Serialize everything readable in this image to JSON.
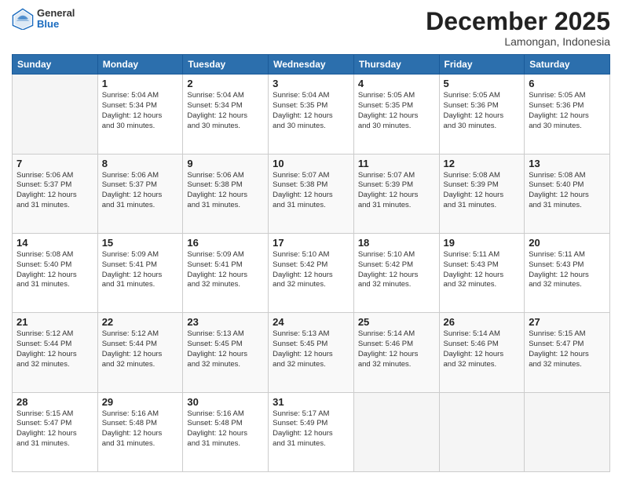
{
  "header": {
    "logo": {
      "general": "General",
      "blue": "Blue"
    },
    "title": "December 2025",
    "subtitle": "Lamongan, Indonesia"
  },
  "days_header": [
    "Sunday",
    "Monday",
    "Tuesday",
    "Wednesday",
    "Thursday",
    "Friday",
    "Saturday"
  ],
  "weeks": [
    [
      {
        "day": "",
        "info": ""
      },
      {
        "day": "1",
        "info": "Sunrise: 5:04 AM\nSunset: 5:34 PM\nDaylight: 12 hours\nand 30 minutes."
      },
      {
        "day": "2",
        "info": "Sunrise: 5:04 AM\nSunset: 5:34 PM\nDaylight: 12 hours\nand 30 minutes."
      },
      {
        "day": "3",
        "info": "Sunrise: 5:04 AM\nSunset: 5:35 PM\nDaylight: 12 hours\nand 30 minutes."
      },
      {
        "day": "4",
        "info": "Sunrise: 5:05 AM\nSunset: 5:35 PM\nDaylight: 12 hours\nand 30 minutes."
      },
      {
        "day": "5",
        "info": "Sunrise: 5:05 AM\nSunset: 5:36 PM\nDaylight: 12 hours\nand 30 minutes."
      },
      {
        "day": "6",
        "info": "Sunrise: 5:05 AM\nSunset: 5:36 PM\nDaylight: 12 hours\nand 30 minutes."
      }
    ],
    [
      {
        "day": "7",
        "info": "Sunrise: 5:06 AM\nSunset: 5:37 PM\nDaylight: 12 hours\nand 31 minutes."
      },
      {
        "day": "8",
        "info": "Sunrise: 5:06 AM\nSunset: 5:37 PM\nDaylight: 12 hours\nand 31 minutes."
      },
      {
        "day": "9",
        "info": "Sunrise: 5:06 AM\nSunset: 5:38 PM\nDaylight: 12 hours\nand 31 minutes."
      },
      {
        "day": "10",
        "info": "Sunrise: 5:07 AM\nSunset: 5:38 PM\nDaylight: 12 hours\nand 31 minutes."
      },
      {
        "day": "11",
        "info": "Sunrise: 5:07 AM\nSunset: 5:39 PM\nDaylight: 12 hours\nand 31 minutes."
      },
      {
        "day": "12",
        "info": "Sunrise: 5:08 AM\nSunset: 5:39 PM\nDaylight: 12 hours\nand 31 minutes."
      },
      {
        "day": "13",
        "info": "Sunrise: 5:08 AM\nSunset: 5:40 PM\nDaylight: 12 hours\nand 31 minutes."
      }
    ],
    [
      {
        "day": "14",
        "info": "Sunrise: 5:08 AM\nSunset: 5:40 PM\nDaylight: 12 hours\nand 31 minutes."
      },
      {
        "day": "15",
        "info": "Sunrise: 5:09 AM\nSunset: 5:41 PM\nDaylight: 12 hours\nand 31 minutes."
      },
      {
        "day": "16",
        "info": "Sunrise: 5:09 AM\nSunset: 5:41 PM\nDaylight: 12 hours\nand 32 minutes."
      },
      {
        "day": "17",
        "info": "Sunrise: 5:10 AM\nSunset: 5:42 PM\nDaylight: 12 hours\nand 32 minutes."
      },
      {
        "day": "18",
        "info": "Sunrise: 5:10 AM\nSunset: 5:42 PM\nDaylight: 12 hours\nand 32 minutes."
      },
      {
        "day": "19",
        "info": "Sunrise: 5:11 AM\nSunset: 5:43 PM\nDaylight: 12 hours\nand 32 minutes."
      },
      {
        "day": "20",
        "info": "Sunrise: 5:11 AM\nSunset: 5:43 PM\nDaylight: 12 hours\nand 32 minutes."
      }
    ],
    [
      {
        "day": "21",
        "info": "Sunrise: 5:12 AM\nSunset: 5:44 PM\nDaylight: 12 hours\nand 32 minutes."
      },
      {
        "day": "22",
        "info": "Sunrise: 5:12 AM\nSunset: 5:44 PM\nDaylight: 12 hours\nand 32 minutes."
      },
      {
        "day": "23",
        "info": "Sunrise: 5:13 AM\nSunset: 5:45 PM\nDaylight: 12 hours\nand 32 minutes."
      },
      {
        "day": "24",
        "info": "Sunrise: 5:13 AM\nSunset: 5:45 PM\nDaylight: 12 hours\nand 32 minutes."
      },
      {
        "day": "25",
        "info": "Sunrise: 5:14 AM\nSunset: 5:46 PM\nDaylight: 12 hours\nand 32 minutes."
      },
      {
        "day": "26",
        "info": "Sunrise: 5:14 AM\nSunset: 5:46 PM\nDaylight: 12 hours\nand 32 minutes."
      },
      {
        "day": "27",
        "info": "Sunrise: 5:15 AM\nSunset: 5:47 PM\nDaylight: 12 hours\nand 32 minutes."
      }
    ],
    [
      {
        "day": "28",
        "info": "Sunrise: 5:15 AM\nSunset: 5:47 PM\nDaylight: 12 hours\nand 31 minutes."
      },
      {
        "day": "29",
        "info": "Sunrise: 5:16 AM\nSunset: 5:48 PM\nDaylight: 12 hours\nand 31 minutes."
      },
      {
        "day": "30",
        "info": "Sunrise: 5:16 AM\nSunset: 5:48 PM\nDaylight: 12 hours\nand 31 minutes."
      },
      {
        "day": "31",
        "info": "Sunrise: 5:17 AM\nSunset: 5:49 PM\nDaylight: 12 hours\nand 31 minutes."
      },
      {
        "day": "",
        "info": ""
      },
      {
        "day": "",
        "info": ""
      },
      {
        "day": "",
        "info": ""
      }
    ]
  ]
}
